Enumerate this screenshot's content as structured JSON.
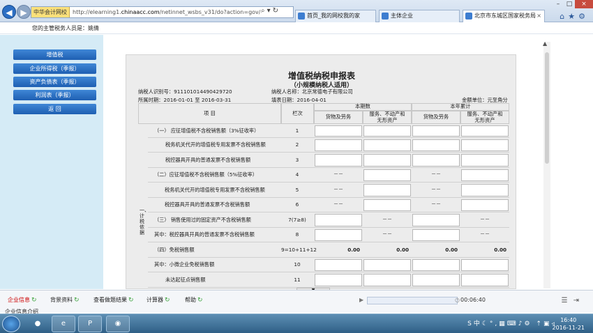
{
  "browser": {
    "back_icon": "back-arrow-icon",
    "forward_icon": "forward-arrow-icon",
    "favorite_label": "中华会计网校",
    "url_prefix": "http://elearning1.",
    "url_domain": "chinaacc.com",
    "url_rest": "/netinnet_wsbs_v31/do?action=gov/",
    "tabs": [
      {
        "label": "首页_我的网校我的家"
      },
      {
        "label": "主体企业"
      },
      {
        "label": "北京市东城区国家税务局"
      }
    ],
    "tab_close": "×",
    "window_controls": [
      "–",
      "□",
      "×"
    ]
  },
  "header": {
    "text": "您的主管税务人员是：姚倩"
  },
  "sidebar": {
    "items": [
      {
        "label": "增值税"
      },
      {
        "label": "企业所得税（季报）"
      },
      {
        "label": "资产负债表（季报）"
      },
      {
        "label": "利润表（季报）"
      },
      {
        "label": "返  回"
      }
    ]
  },
  "form": {
    "title": "增值税纳税申报表",
    "subtitle": "（小规模纳税人适用）",
    "taxpayer_id_label": "纳税人识别号：",
    "taxpayer_id": "911101014490429720",
    "taxpayer_name_label": "纳税人名称：",
    "taxpayer_name": "北京常德电子有限公司",
    "period_label": "所属时期：",
    "period": "2016-01-01 至  2016-03-31",
    "fill_date_label": "填表日期：",
    "fill_date": "2016-04-01",
    "unit": "金额单位：元至角分",
    "headers": {
      "item": "项 目",
      "col": "栏次",
      "current": "本期数",
      "ytd": "本年累计",
      "goods": "货物及劳务",
      "services": "服务、不动产和无形资产"
    },
    "section_label": "一、计税依据",
    "rows": [
      {
        "label": "（一） 应征增值税不含税销售额（3%征收率）",
        "no": "1"
      },
      {
        "label": "税务机关代开的增值税专用发票不含税销售额",
        "no": "2"
      },
      {
        "label": "税控器具开具的普通发票不含税销售额",
        "no": "3"
      },
      {
        "label": "（二）应征增值税不含税销售额（5%征收率）",
        "no": "4"
      },
      {
        "label": "税务机关代开的增值税专用发票不含税销售额",
        "no": "5"
      },
      {
        "label": "税控器具开具的普通发票不含税销售额",
        "no": "6"
      },
      {
        "label": "（三） 销售使用过的固定资产不含税销售额",
        "no": "7(7≥8)"
      },
      {
        "label": "其中：税控器具开具的普通发票不含税销售额",
        "no": "8"
      },
      {
        "label": "（四）免税销售额",
        "no": "9=10+11+12"
      },
      {
        "label": "其中：小微企业免税销售额",
        "no": "10"
      },
      {
        "label": "未达起征点销售额",
        "no": "11"
      }
    ],
    "dash": "－－",
    "zero": "0.00"
  },
  "bottom": {
    "tabs": [
      {
        "label": "企业信息"
      },
      {
        "label": "背景资料"
      },
      {
        "label": "查看做题结果"
      },
      {
        "label": "计算器"
      },
      {
        "label": "帮助"
      }
    ],
    "time": "00:06:40",
    "second_line": "企业信息介绍"
  },
  "taskbar": {
    "time": "16:40",
    "date": "2016-11-21",
    "ime": "中"
  }
}
